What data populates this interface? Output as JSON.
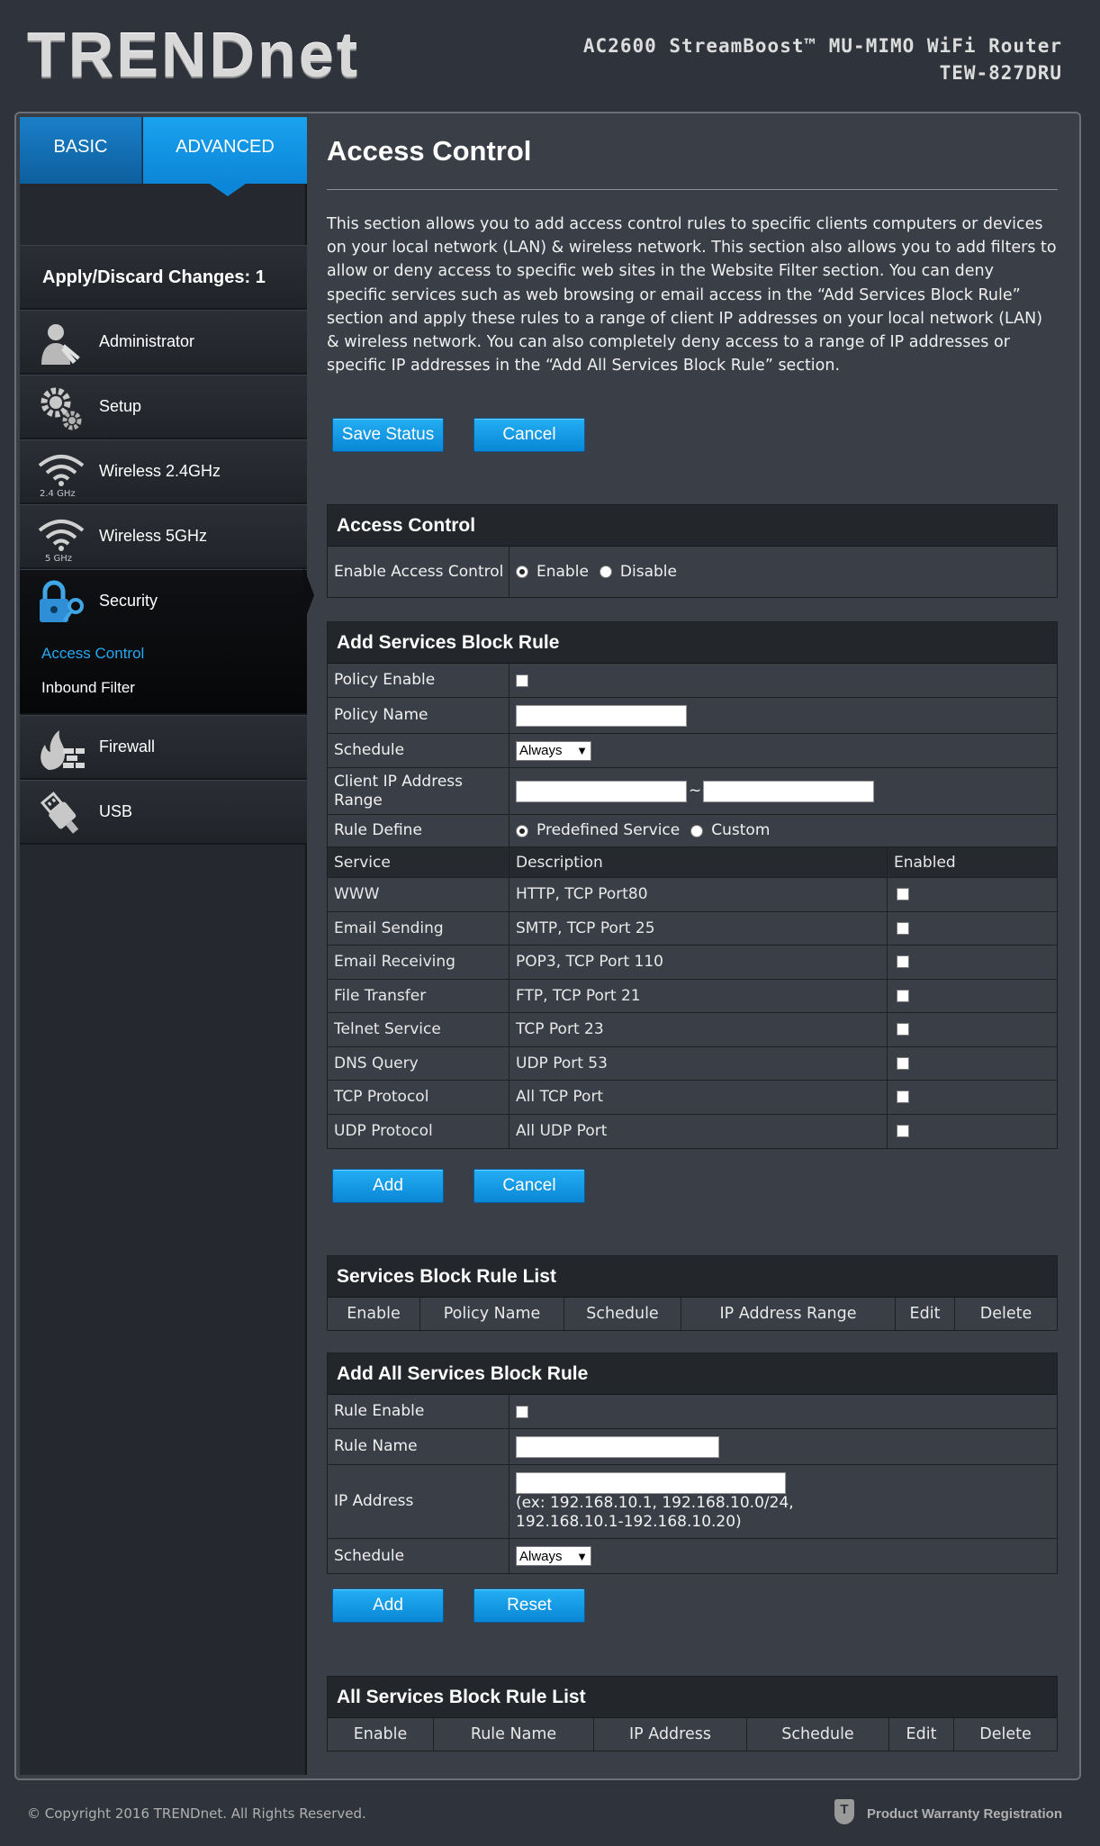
{
  "header": {
    "logo": "TRENDnet",
    "product_line1": "AC2600 StreamBoost™ MU-MIMO WiFi Router",
    "product_line2": "TEW-827DRU"
  },
  "tabs": {
    "basic": "BASIC",
    "advanced": "ADVANCED"
  },
  "sidebar": {
    "apply_label": "Apply/Discard Changes: 1",
    "items": [
      {
        "label": "Administrator",
        "icon": "administrator-icon"
      },
      {
        "label": "Setup",
        "icon": "gears-icon"
      },
      {
        "label": "Wireless 2.4GHz",
        "icon": "wifi-24ghz-icon",
        "icon_caption": "2.4 GHz"
      },
      {
        "label": "Wireless 5GHz",
        "icon": "wifi-5ghz-icon",
        "icon_caption": "5 GHz"
      },
      {
        "label": "Security",
        "icon": "lock-key-icon"
      },
      {
        "label": "Firewall",
        "icon": "firewall-icon"
      },
      {
        "label": "USB",
        "icon": "usb-icon"
      }
    ],
    "security_sub": [
      {
        "label": "Access Control",
        "active": true
      },
      {
        "label": "Inbound Filter",
        "active": false
      }
    ]
  },
  "main": {
    "title": "Access Control",
    "description": "This section allows you to add access control rules to specific clients computers or devices on your local network (LAN) & wireless network. This section also allows you to add filters to allow or deny access to specific web sites in the Website Filter section. You can deny specific services such as web browsing or email access in the “Add Services Block Rule” section and apply these rules to a range of client IP addresses on your local network (LAN) & wireless network. You can also completely deny access to a range of IP addresses or specific IP addresses in the “Add All Services Block Rule” section.",
    "save_status": "Save Status",
    "cancel": "Cancel",
    "access_control": {
      "header": "Access Control",
      "enable_label": "Enable Access Control",
      "enable_option": "Enable",
      "disable_option": "Disable",
      "selected": "Enable"
    },
    "services_block": {
      "header": "Add Services Block Rule",
      "policy_enable": "Policy Enable",
      "policy_name": "Policy Name",
      "schedule": "Schedule",
      "schedule_value": "Always",
      "client_ip_range": "Client IP Address Range",
      "range_sep": "~",
      "rule_define": "Rule Define",
      "predefined": "Predefined Service",
      "custom": "Custom",
      "columns": [
        "Service",
        "Description",
        "Enabled"
      ],
      "services": [
        {
          "service": "WWW",
          "description": "HTTP, TCP Port80"
        },
        {
          "service": "Email Sending",
          "description": "SMTP, TCP Port 25"
        },
        {
          "service": "Email Receiving",
          "description": "POP3, TCP Port 110"
        },
        {
          "service": "File Transfer",
          "description": "FTP, TCP Port 21"
        },
        {
          "service": "Telnet Service",
          "description": "TCP Port 23"
        },
        {
          "service": "DNS Query",
          "description": "UDP Port 53"
        },
        {
          "service": "TCP Protocol",
          "description": "All TCP Port"
        },
        {
          "service": "UDP Protocol",
          "description": "All UDP Port"
        }
      ],
      "add": "Add",
      "cancel": "Cancel"
    },
    "services_list": {
      "header": "Services Block Rule List",
      "columns": [
        "Enable",
        "Policy Name",
        "Schedule",
        "IP Address Range",
        "Edit",
        "Delete"
      ]
    },
    "all_services": {
      "header": "Add All Services Block Rule",
      "rule_enable": "Rule Enable",
      "rule_name": "Rule Name",
      "ip_address": "IP Address",
      "ip_hint": "(ex: 192.168.10.1, 192.168.10.0/24, 192.168.10.1-192.168.10.20)",
      "schedule": "Schedule",
      "schedule_value": "Always",
      "add": "Add",
      "reset": "Reset"
    },
    "all_services_list": {
      "header": "All Services Block Rule List",
      "columns": [
        "Enable",
        "Rule Name",
        "IP Address",
        "Schedule",
        "Edit",
        "Delete"
      ]
    }
  },
  "footer": {
    "copyright": "© Copyright 2016 TRENDnet. All Rights Reserved.",
    "warranty": "Product Warranty Registration"
  },
  "colors": {
    "accent": "#0c8ad8",
    "active_sub": "#27a9f0",
    "page_bg": "#2f333b"
  }
}
